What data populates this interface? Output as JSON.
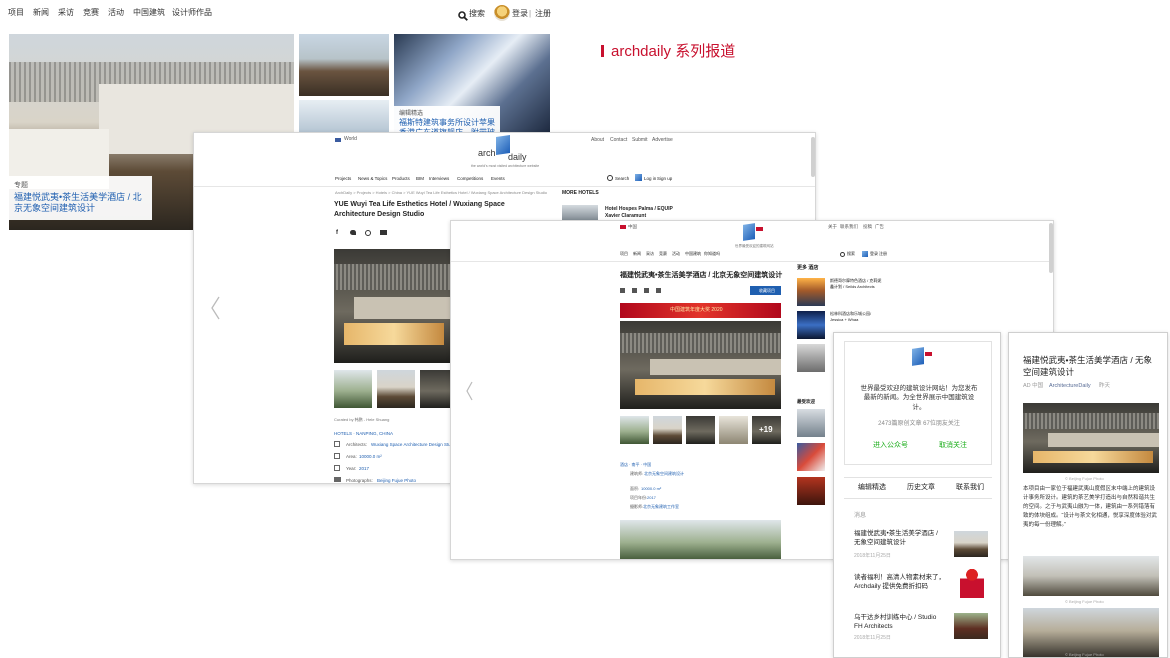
{
  "gooood": {
    "nav": [
      "项目",
      "新闻",
      "采访",
      "竞赛",
      "活动",
      "中国建筑",
      "设计师作品"
    ],
    "search_label": "搜索",
    "login_label": "登录",
    "divider": "|",
    "register_label": "注册",
    "hero_tag": "专题",
    "hero_caption": "福建悦武夷•茶生活美学酒店 / 北京无象空间建筑设计",
    "sub_tag": "编辑精选",
    "sub_caption": "福斯特建筑事务所设计苹果香港广东道旗舰店，附带玻璃平台"
  },
  "headline": "archdaily 系列报道",
  "archdaily_en": {
    "region": "World",
    "top_links": [
      "About",
      "Contact",
      "Submit",
      "Advertise"
    ],
    "logo_arch": "arch",
    "logo_daily": "daily",
    "tagline": "the world's most visited architecture website",
    "nav": [
      "Projects",
      "News & Topics",
      "Products",
      "BIM",
      "Interviews",
      "Competitions",
      "Events"
    ],
    "search_label": "Search",
    "login_label": "Log in",
    "signup_label": "Sign up",
    "breadcrumb": "ArchDaily > Projects > Hotels > China > YUE Wuyi Tea Life Esthetics Hotel / Wuxiang Space Architecture Design Studio",
    "title": "YUE Wuyi Tea Life Esthetics Hotel / Wuxiang Space Architecture Design Studio",
    "more_heading": "MORE HOTELS",
    "more_items": [
      "Hotel Hospes Palma / EQUIP Xavier Claramunt"
    ],
    "curated": "Curated by 韩鹏 - Hele Shuang",
    "location": "HOTELS · NANPING, CHINA",
    "specs": [
      {
        "label": "Architects:",
        "value": "Wuxiang Space Architecture Design Studio"
      },
      {
        "label": "Area:",
        "value": "10000.0 m²"
      },
      {
        "label": "Year:",
        "value": "2017"
      },
      {
        "label": "Photographs:",
        "value": "Beijing Fujue Photo"
      }
    ]
  },
  "archdaily_cn": {
    "region": "中国",
    "top_links": [
      "关于",
      "联系我们",
      "投稿",
      "广告"
    ],
    "tagline": "世界最受欢迎的建筑网站",
    "nav": [
      "项目",
      "新闻",
      "采访",
      "竞赛",
      "活动",
      "中国建筑",
      "你知道吗"
    ],
    "search_label": "搜索",
    "login_label": "登录",
    "signup_label": "注册",
    "title": "福建悦武夷•茶生活美学酒店 / 北京无象空间建筑设计",
    "save_button": "收藏项目",
    "banner": "中国建筑年度大奖 2020",
    "thumb_more": "+19",
    "more_heading": "更多 酒店",
    "more_items": [
      "斯德哥尔摩特色酒店 / 克莉妮鑫计划 / Seilds Architects",
      "松林科酒店和乐城公园/ Jessica + Whaa"
    ],
    "recommend_heading": "最受欢迎",
    "location": "酒店 · 南平 · 中国",
    "specs": [
      {
        "label": "建筑师:",
        "value": "北京无象空间建筑设计"
      },
      {
        "label": "面积:",
        "value": "10000.0 m²"
      },
      {
        "label": "项目年份:",
        "value": "2017"
      },
      {
        "label": "摄影师:",
        "value": "北京无象建筑工作室"
      }
    ]
  },
  "wechat_profile": {
    "welcome": "世界最受欢迎的建筑设计网站！为您发布最新的新闻。为全世界展示中国建筑设计。",
    "stats": "2473篇原创文章 67位朋友关注",
    "enter_button": "进入公众号",
    "unfollow_button": "取消关注",
    "tabs": [
      "编辑精选",
      "历史文章",
      "联系我们"
    ],
    "section_label": "消息",
    "messages": [
      {
        "title": "福建悦武夷•茶生活美学酒店 / 无象空间建筑设计",
        "date": "2018年11月25日"
      },
      {
        "title": "读者福利！高清人物素材来了，Archdaily 提供免费折扣码",
        "date": "2018年11月25日"
      },
      {
        "title": "乌干达乡村训练中心 / Studio FH Architects",
        "date": "2018年11月25日"
      }
    ]
  },
  "wechat_article": {
    "title": "福建悦武夷•茶生活美学酒店 / 无象空间建筑设计",
    "meta_author": "AD 中国",
    "meta_account": "ArchitectureDaily",
    "meta_date": "昨天",
    "caption_1": "© Beijing Fujue Photo",
    "body": "本项目由一家位于福建武夷山度假区末中端上的建筑设计事务所设计。建筑的茶艺美学打造出与自然和谐共生的空间。之于与武夷山融为一体，建筑由一系列错落有致的体块组成。“设计与茶文化相通，悦享深度体验对武夷的每一份理解。”",
    "caption_2": "© Beijing Fujue Photo",
    "caption_3": "© Beijing Fujue Photo"
  },
  "colors": {
    "accent_red": "#c8102e",
    "link_blue": "#1f5fb0",
    "wechat_green": "#1aad19"
  }
}
